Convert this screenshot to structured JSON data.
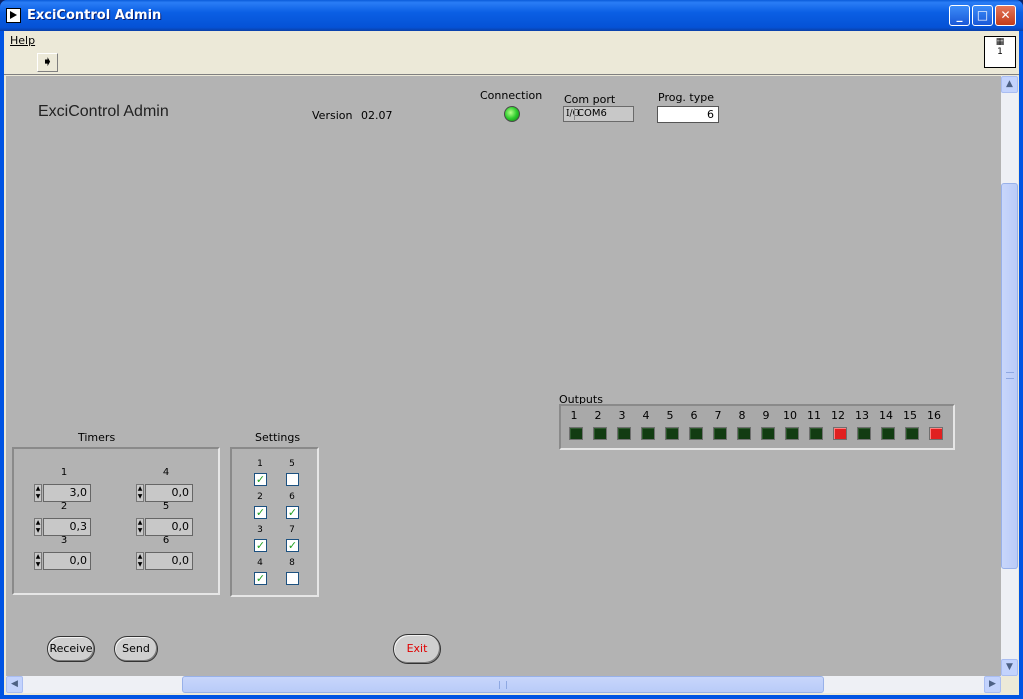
{
  "window": {
    "title": "ExciControl Admin"
  },
  "menu": {
    "help": "Help"
  },
  "toolbar": {
    "vi_icon_text": "1"
  },
  "header": {
    "app_title": "ExciControl Admin",
    "version_label": "Version",
    "version_value": "02.07",
    "connection_label": "Connection",
    "connection_status_color": "#2ecc2e",
    "com_port_label": "Com port",
    "com_port_value": "COM6",
    "prog_type_label": "Prog. type",
    "prog_type_value": "6"
  },
  "outputs": {
    "label": "Outputs",
    "items": [
      {
        "n": "1",
        "on": false
      },
      {
        "n": "2",
        "on": false
      },
      {
        "n": "3",
        "on": false
      },
      {
        "n": "4",
        "on": false
      },
      {
        "n": "5",
        "on": false
      },
      {
        "n": "6",
        "on": false
      },
      {
        "n": "7",
        "on": false
      },
      {
        "n": "8",
        "on": false
      },
      {
        "n": "9",
        "on": false
      },
      {
        "n": "10",
        "on": false
      },
      {
        "n": "11",
        "on": false
      },
      {
        "n": "12",
        "on": true
      },
      {
        "n": "13",
        "on": false
      },
      {
        "n": "14",
        "on": false
      },
      {
        "n": "15",
        "on": false
      },
      {
        "n": "16",
        "on": true
      }
    ]
  },
  "timers": {
    "label": "Timers",
    "items": [
      {
        "n": "1",
        "value": "3,0"
      },
      {
        "n": "2",
        "value": "0,3"
      },
      {
        "n": "3",
        "value": "0,0"
      },
      {
        "n": "4",
        "value": "0,0"
      },
      {
        "n": "5",
        "value": "0,0"
      },
      {
        "n": "6",
        "value": "0,0"
      }
    ]
  },
  "settings": {
    "label": "Settings",
    "items": [
      {
        "n": "1",
        "checked": true
      },
      {
        "n": "2",
        "checked": true
      },
      {
        "n": "3",
        "checked": true
      },
      {
        "n": "4",
        "checked": true
      },
      {
        "n": "5",
        "checked": false
      },
      {
        "n": "6",
        "checked": true
      },
      {
        "n": "7",
        "checked": true
      },
      {
        "n": "8",
        "checked": false
      }
    ]
  },
  "buttons": {
    "receive": "Receive",
    "send": "Send",
    "exit": "Exit"
  }
}
